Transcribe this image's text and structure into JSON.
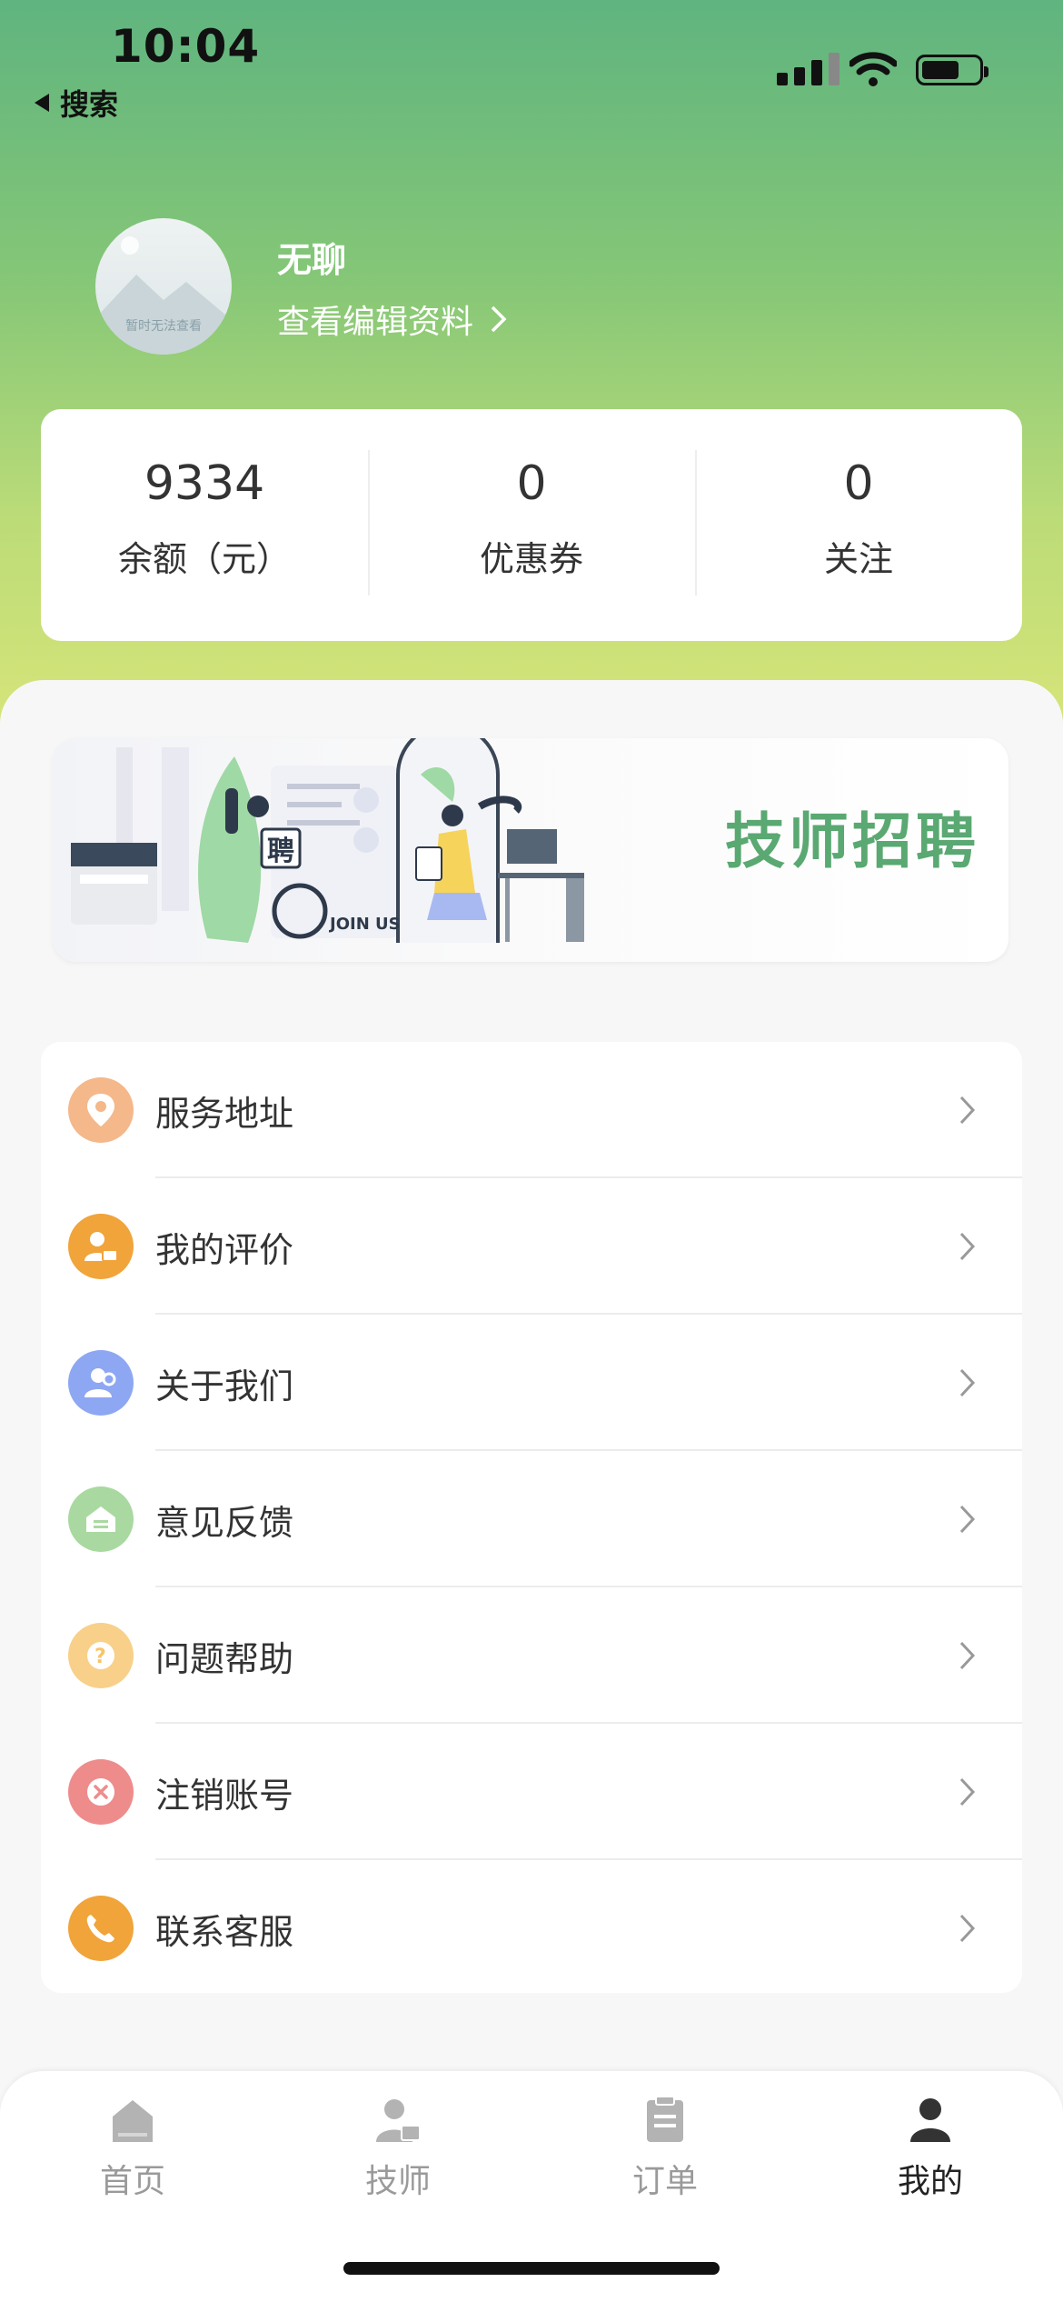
{
  "status_bar": {
    "time": "10:04",
    "back_label": "搜索"
  },
  "profile": {
    "avatar_caption": "暂时无法查看",
    "username": "无聊",
    "edit_link": "查看编辑资料"
  },
  "stats": [
    {
      "value": "9334",
      "label": "余额（元）"
    },
    {
      "value": "0",
      "label": "优惠券"
    },
    {
      "value": "0",
      "label": "关注"
    }
  ],
  "banner": {
    "title": "技师招聘",
    "join_text": "JOIN US",
    "hire_char": "聘"
  },
  "menu": [
    {
      "label": "服务地址",
      "icon": "location-pin-icon",
      "color": "#f4b88a"
    },
    {
      "label": "我的评价",
      "icon": "user-review-icon",
      "color": "#f0a43a"
    },
    {
      "label": "关于我们",
      "icon": "users-icon",
      "color": "#8ea7f3"
    },
    {
      "label": "意见反馈",
      "icon": "feedback-house-icon",
      "color": "#a9d9a0"
    },
    {
      "label": "问题帮助",
      "icon": "question-icon",
      "color": "#f8d08a"
    },
    {
      "label": "注销账号",
      "icon": "close-circle-icon",
      "color": "#ee8c8c"
    },
    {
      "label": "联系客服",
      "icon": "phone-icon",
      "color": "#f0a43a"
    }
  ],
  "tabs": [
    {
      "label": "首页",
      "icon": "home-icon"
    },
    {
      "label": "技师",
      "icon": "technician-icon"
    },
    {
      "label": "订单",
      "icon": "clipboard-icon"
    },
    {
      "label": "我的",
      "icon": "person-icon"
    }
  ],
  "colors": {
    "brand_green": "#5aa872",
    "gradient_top": "#5fb47f",
    "gradient_bottom": "#d8e579"
  }
}
